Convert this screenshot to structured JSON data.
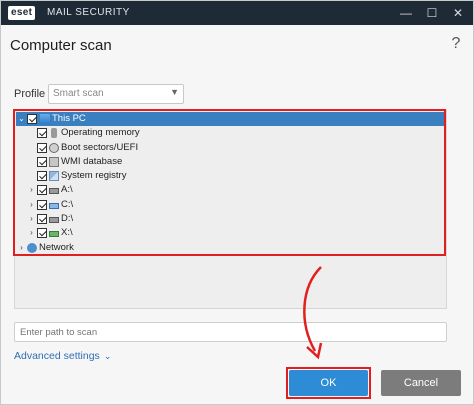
{
  "titlebar": {
    "logo": "eset",
    "app_name": "MAIL SECURITY",
    "minimize": "—",
    "maximize": "☐",
    "close": "✕"
  },
  "header": {
    "title": "Computer scan",
    "help": "?"
  },
  "profile": {
    "label": "Profile",
    "selected": "Smart scan"
  },
  "tree": {
    "items": [
      {
        "label": "This PC",
        "checked": true,
        "expanded": true,
        "icon": "computer-icon"
      },
      {
        "label": "Operating memory",
        "checked": true,
        "icon": "memory-icon"
      },
      {
        "label": "Boot sectors/UEFI",
        "checked": true,
        "icon": "boot-sector-icon"
      },
      {
        "label": "WMI database",
        "checked": true,
        "icon": "wmi-database-icon"
      },
      {
        "label": "System registry",
        "checked": true,
        "icon": "registry-icon"
      },
      {
        "label": "A:\\",
        "checked": true,
        "icon": "drive-icon"
      },
      {
        "label": "C:\\",
        "checked": true,
        "icon": "drive-icon"
      },
      {
        "label": "D:\\",
        "checked": true,
        "icon": "drive-icon"
      },
      {
        "label": "X:\\",
        "checked": true,
        "icon": "drive-icon"
      },
      {
        "label": "Network",
        "checked": false,
        "icon": "network-icon"
      }
    ]
  },
  "path": {
    "placeholder": "Enter path to scan"
  },
  "advanced": {
    "label": "Advanced settings"
  },
  "buttons": {
    "ok": "OK",
    "cancel": "Cancel"
  },
  "colors": {
    "titlebar": "#1f2a37",
    "selection": "#3a7fc0",
    "primary_button": "#2e8bd6",
    "secondary_button": "#7c7c7c",
    "highlight_outline": "#e02020",
    "link": "#2f6fb3"
  }
}
